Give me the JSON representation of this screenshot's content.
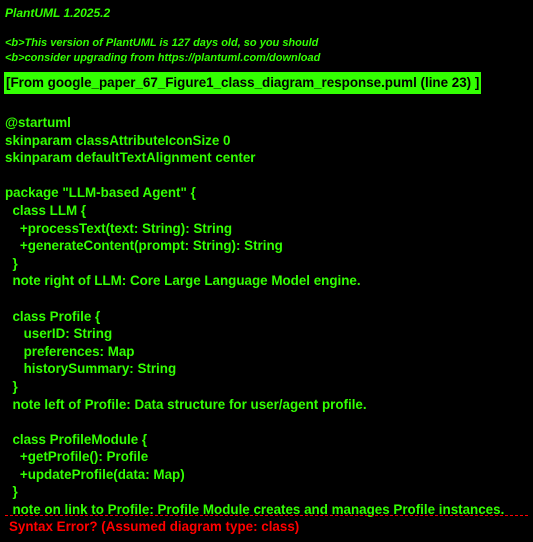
{
  "header": {
    "title": "PlantUML 1.2025.2",
    "warning_line1": "<b>This version of PlantUML is 127 days old, so you should",
    "warning_line2": "<b>consider upgrading from https://plantuml.com/download"
  },
  "banner": {
    "text": "[From google_paper_67_Figure1_class_diagram_response.puml (line 23) ]"
  },
  "code_lines": [
    "@startuml",
    "skinparam classAttributeIconSize 0",
    "skinparam defaultTextAlignment center",
    "",
    "package \"LLM-based Agent\" {",
    "  class LLM {",
    "    +processText(text: String): String",
    "    +generateContent(prompt: String): String",
    "  }",
    "  note right of LLM: Core Large Language Model engine.",
    "",
    "  class Profile {",
    "     userID: String",
    "     preferences: Map",
    "     historySummary: String",
    "  }",
    "  note left of Profile: Data structure for user/agent profile.",
    "",
    "  class ProfileModule {",
    "    +getProfile(): Profile",
    "    +updateProfile(data: Map)",
    "  }",
    "  note on link to Profile: Profile Module creates and manages Profile instances."
  ],
  "error": {
    "text": "Syntax Error? (Assumed diagram type: class)"
  },
  "colors": {
    "background": "#000000",
    "text": "#33ff02",
    "error": "#ff0000"
  }
}
